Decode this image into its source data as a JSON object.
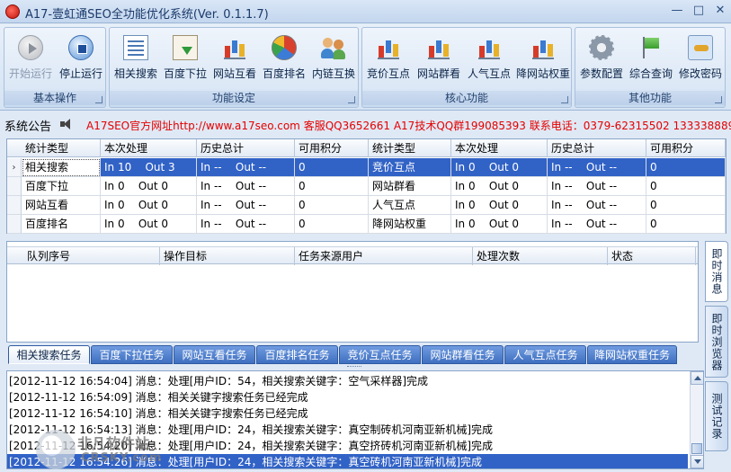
{
  "window": {
    "title": "A17-壹虹通SEO全功能优化系统(Ver. 0.1.1.7)",
    "min": "—",
    "max": "□",
    "close": "✕"
  },
  "ribbon": {
    "groups": [
      {
        "label": "基本操作",
        "buttons": [
          {
            "label": "开始运行",
            "icon": "play-icon",
            "enabled": false
          },
          {
            "label": "停止运行",
            "icon": "stop-icon",
            "enabled": true
          }
        ]
      },
      {
        "label": "功能设定",
        "buttons": [
          {
            "label": "相关搜索",
            "icon": "list-icon"
          },
          {
            "label": "百度下拉",
            "icon": "download-icon"
          },
          {
            "label": "网站互看",
            "icon": "bar-chart-icon"
          },
          {
            "label": "百度排名",
            "icon": "pie-chart-icon"
          },
          {
            "label": "内链互换",
            "icon": "people-icon"
          }
        ]
      },
      {
        "label": "核心功能",
        "buttons": [
          {
            "label": "竞价互点",
            "icon": "bar-chart-icon"
          },
          {
            "label": "网站群看",
            "icon": "bar-chart-icon"
          },
          {
            "label": "人气互点",
            "icon": "bar-chart-icon"
          },
          {
            "label": "降网站权重",
            "icon": "bar-chart-icon"
          }
        ]
      },
      {
        "label": "其他功能",
        "buttons": [
          {
            "label": "参数配置",
            "icon": "gear-icon"
          },
          {
            "label": "综合查询",
            "icon": "flag-icon"
          },
          {
            "label": "修改密码",
            "icon": "key-icon"
          }
        ]
      }
    ]
  },
  "notice": {
    "label": "系统公告",
    "text": "A17SEO官方网址http://www.a17seo.com 客服QQ3652661 A17技术QQ群199085393 联系电话：0379-62315502 13333888916"
  },
  "stats": {
    "headers": [
      "统计类型",
      "本次处理",
      "历史总计",
      "可用积分",
      "统计类型",
      "本次处理",
      "历史总计",
      "可用积分"
    ],
    "rows": [
      [
        "相关搜索",
        "In 10    Out 3",
        "In --    Out --",
        "0",
        "竞价互点",
        "In 0    Out 0",
        "In --    Out --",
        "0"
      ],
      [
        "百度下拉",
        "In 0    Out 0",
        "In --    Out --",
        "0",
        "网站群看",
        "In 0    Out 0",
        "In --    Out --",
        "0"
      ],
      [
        "网站互看",
        "In 0    Out 0",
        "In --    Out --",
        "0",
        "人气互点",
        "In 0    Out 0",
        "In --    Out --",
        "0"
      ],
      [
        "百度排名",
        "In 0    Out 0",
        "In --    Out --",
        "0",
        "降网站权重",
        "In 0    Out 0",
        "In --    Out --",
        "0"
      ]
    ],
    "row_indicator": "›"
  },
  "queue": {
    "headers": [
      "队列序号",
      "操作目标",
      "任务来源用户",
      "处理次数",
      "状态"
    ]
  },
  "side_tabs": [
    "即时消息",
    "即时浏览器",
    "测试记录"
  ],
  "task_tabs": [
    "相关搜索任务",
    "百度下拉任务",
    "网站互看任务",
    "百度排名任务",
    "竞价互点任务",
    "网站群看任务",
    "人气互点任务",
    "降网站权重任务"
  ],
  "log": [
    "[2012-11-12 16:54:04] 消息：处理[用户ID：54，相关搜索关键字：空气采样器]完成",
    "[2012-11-12 16:54:09] 消息：相关关键字搜索任务已经完成",
    "[2012-11-12 16:54:10] 消息：相关关键字搜索任务已经完成",
    "[2012-11-12 16:54:13] 消息：处理[用户ID：24，相关搜索关键字：真空制砖机河南亚新机械]完成",
    "[2012-11-12 16:54:20] 消息：处理[用户ID：24，相关搜索关键字：真空挤砖机河南亚新机械]完成",
    "[2012-11-12 16:54:26] 消息：处理[用户ID：24，相关搜索关键字：真空砖机河南亚新机械]完成"
  ],
  "watermark": {
    "cn": "非凡软件站",
    "en": "CRSKY.com"
  }
}
